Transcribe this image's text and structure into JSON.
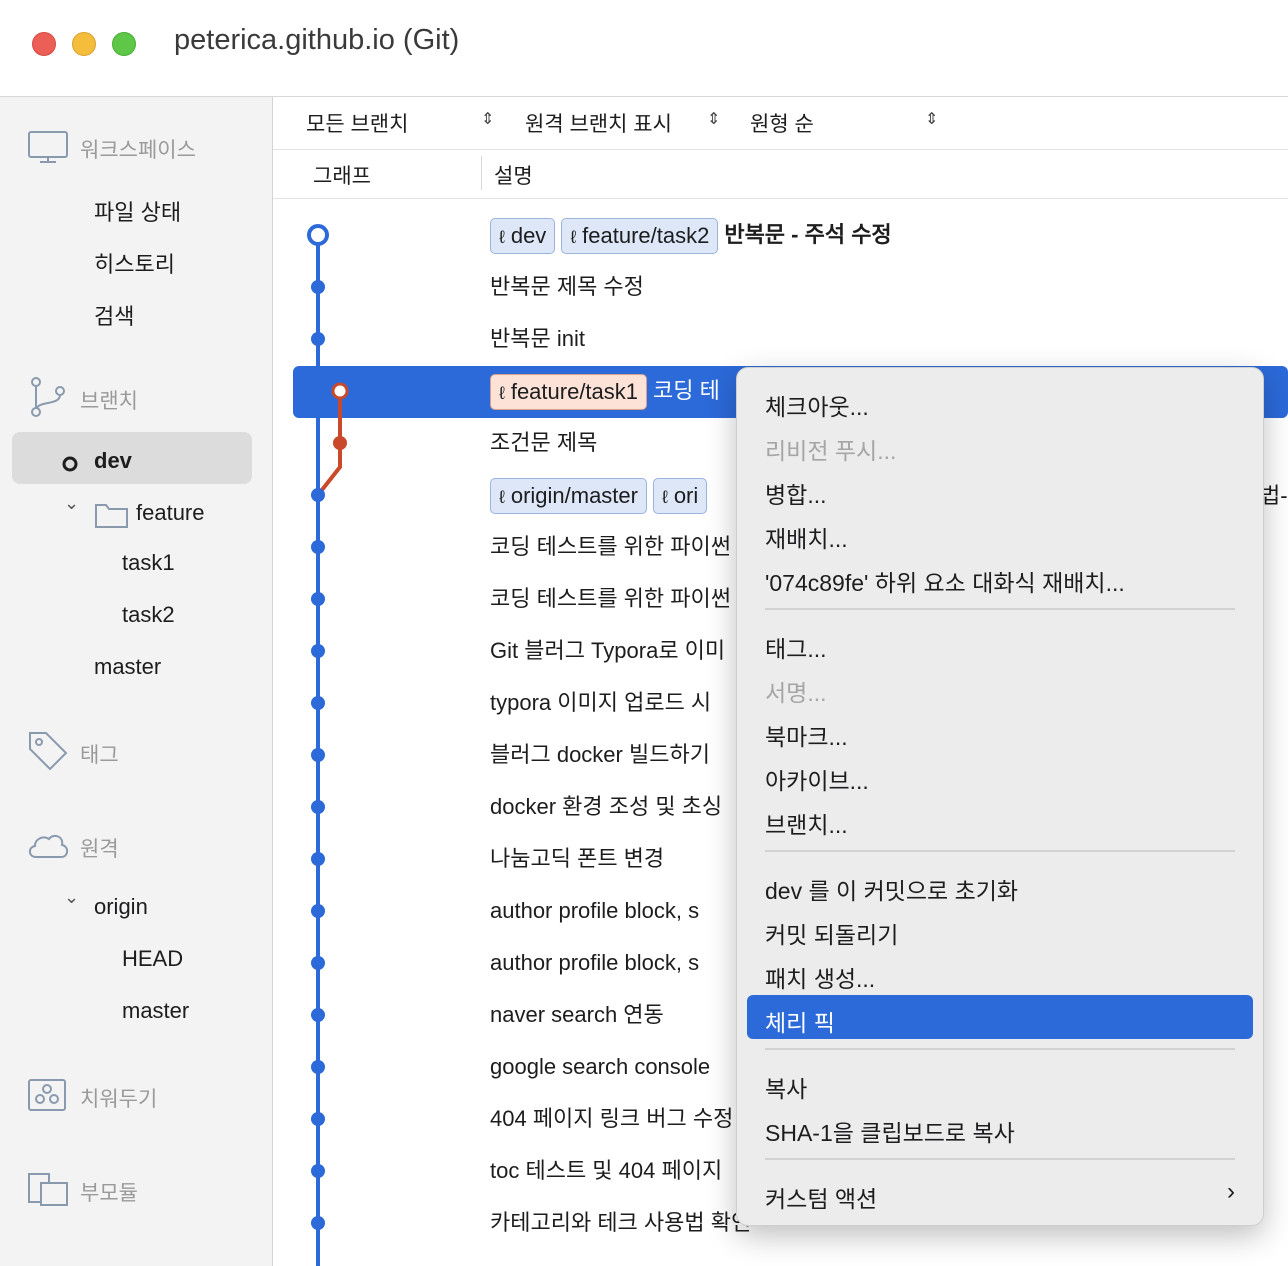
{
  "window": {
    "title": "peterica.github.io (Git)"
  },
  "sidebar": {
    "workspace": {
      "label": "워크스페이스",
      "items": [
        "파일 상태",
        "히스토리",
        "검색"
      ]
    },
    "branches": {
      "label": "브랜치",
      "current": "dev",
      "folder": "feature",
      "children": [
        "task1",
        "task2"
      ],
      "master": "master"
    },
    "tags": {
      "label": "태그"
    },
    "remotes": {
      "label": "원격",
      "origin": "origin",
      "children": [
        "HEAD",
        "master"
      ]
    },
    "stashes": {
      "label": "치워두기"
    },
    "submodules": {
      "label": "부모듈"
    }
  },
  "toolbar": {
    "branch_filter": "모든 브랜치",
    "remote_filter": "원격 브랜치 표시",
    "order": "원형 순"
  },
  "columns": {
    "graph": "그래프",
    "description": "설명"
  },
  "commits": [
    {
      "badges": [
        "dev",
        "feature/task2"
      ],
      "message": "반복문 - 주석 수정"
    },
    {
      "message": "반복문 제목 수정"
    },
    {
      "message": "반복문 init"
    },
    {
      "badges": [
        "feature/task1"
      ],
      "message": "코딩 테"
    },
    {
      "message": "조건문 제목"
    },
    {
      "badges": [
        "origin/master",
        "ori"
      ],
      "message": ""
    },
    {
      "message": "코딩 테스트를 위한 파이썬"
    },
    {
      "message": "코딩 테스트를 위한 파이썬"
    },
    {
      "message": "Git 블러그 Typora로 이미"
    },
    {
      "message": "typora 이미지 업로드 시"
    },
    {
      "message": "블러그 docker 빌드하기"
    },
    {
      "message": "docker 환경 조성 및 초싱"
    },
    {
      "message": "나눔고딕 폰트 변경"
    },
    {
      "message": "author profile block, s"
    },
    {
      "message": "author profile block, s"
    },
    {
      "message": "naver search 연동"
    },
    {
      "message": "google search console"
    },
    {
      "message": "404 페이지 링크 버그 수정"
    },
    {
      "message": "toc 테스트 및 404 페이지"
    },
    {
      "message": "카테고리와 테크 사용법 확인"
    }
  ],
  "overflow_text": "법-",
  "context_menu": {
    "items": [
      {
        "label": "체크아웃...",
        "enabled": true
      },
      {
        "label": "리비전 푸시...",
        "enabled": false
      },
      {
        "label": "병합...",
        "enabled": true
      },
      {
        "label": "재배치...",
        "enabled": true
      },
      {
        "label": "'074c89fe' 하위 요소 대화식 재배치...",
        "enabled": true
      },
      {
        "label": "태그...",
        "enabled": true
      },
      {
        "label": "서명...",
        "enabled": false
      },
      {
        "label": "북마크...",
        "enabled": true
      },
      {
        "label": "아카이브...",
        "enabled": true
      },
      {
        "label": "브랜치...",
        "enabled": true
      },
      {
        "label": "dev 를 이 커밋으로 초기화",
        "enabled": true
      },
      {
        "label": "커밋 되돌리기",
        "enabled": true
      },
      {
        "label": "패치 생성...",
        "enabled": true
      },
      {
        "label": "체리 픽",
        "enabled": true,
        "highlighted": true
      },
      {
        "label": "복사",
        "enabled": true
      },
      {
        "label": "SHA-1을 클립보드로 복사",
        "enabled": true
      },
      {
        "label": "커스텀 액션",
        "enabled": true,
        "submenu": true
      }
    ]
  },
  "colors": {
    "accent": "#2c6ad9",
    "graph_blue": "#2c6ad9",
    "graph_orange": "#c9492a"
  }
}
